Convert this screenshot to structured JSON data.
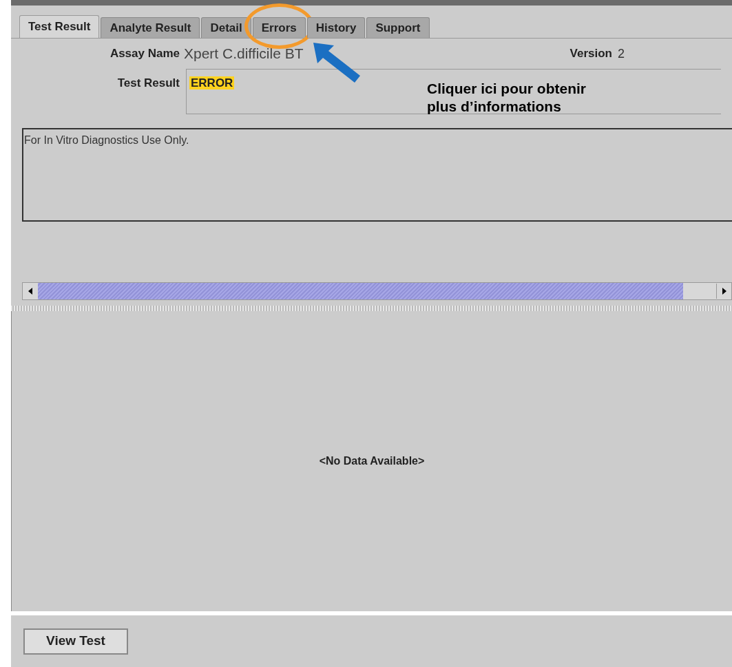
{
  "tabs": [
    {
      "label": "Test Result",
      "selected": true
    },
    {
      "label": "Analyte Result",
      "selected": false
    },
    {
      "label": "Detail",
      "selected": false
    },
    {
      "label": "Errors",
      "selected": false,
      "circled": true
    },
    {
      "label": "History",
      "selected": false
    },
    {
      "label": "Support",
      "selected": false
    }
  ],
  "assay_name": {
    "label": "Assay Name",
    "value": "Xpert C.difficile BT"
  },
  "version": {
    "label": "Version",
    "value": "2"
  },
  "test_result": {
    "label": "Test Result",
    "value": "ERROR"
  },
  "notes": "For In Vitro Diagnostics Use Only.",
  "annotation": {
    "text": "Cliquer ici pour obtenir plus d’informations"
  },
  "lower_panel": {
    "message": "<No Data Available>"
  },
  "buttons": [
    "View Test"
  ]
}
